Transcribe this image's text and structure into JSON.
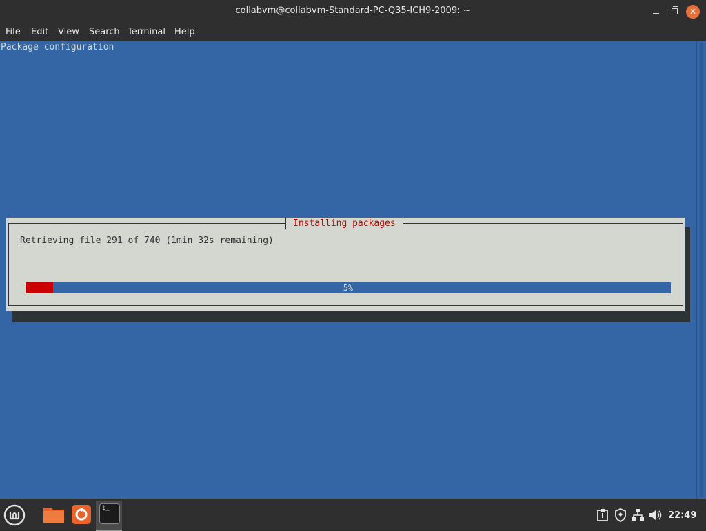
{
  "window": {
    "title": "collabvm@collabvm-Standard-PC-Q35-ICH9-2009: ~"
  },
  "menu": {
    "items": [
      "File",
      "Edit",
      "View",
      "Search",
      "Terminal",
      "Help"
    ]
  },
  "terminal": {
    "header_line": "Package configuration",
    "background": "#3465a4"
  },
  "dialog": {
    "title": "Installing packages",
    "message": "Retrieving file 291 of 740 (1min 32s remaining)",
    "progress_percent": 5,
    "progress_label": "5%",
    "progress_color": "#cc0000",
    "title_color": "#cc0000"
  },
  "taskbar": {
    "icons": [
      "mint-menu-icon",
      "files-icon",
      "update-manager-icon",
      "terminal-icon"
    ],
    "tray_icons": [
      "clipboard-icon",
      "shield-icon",
      "network-icon",
      "volume-icon"
    ],
    "clock": "22:49",
    "terminal_glyph": "$_"
  }
}
